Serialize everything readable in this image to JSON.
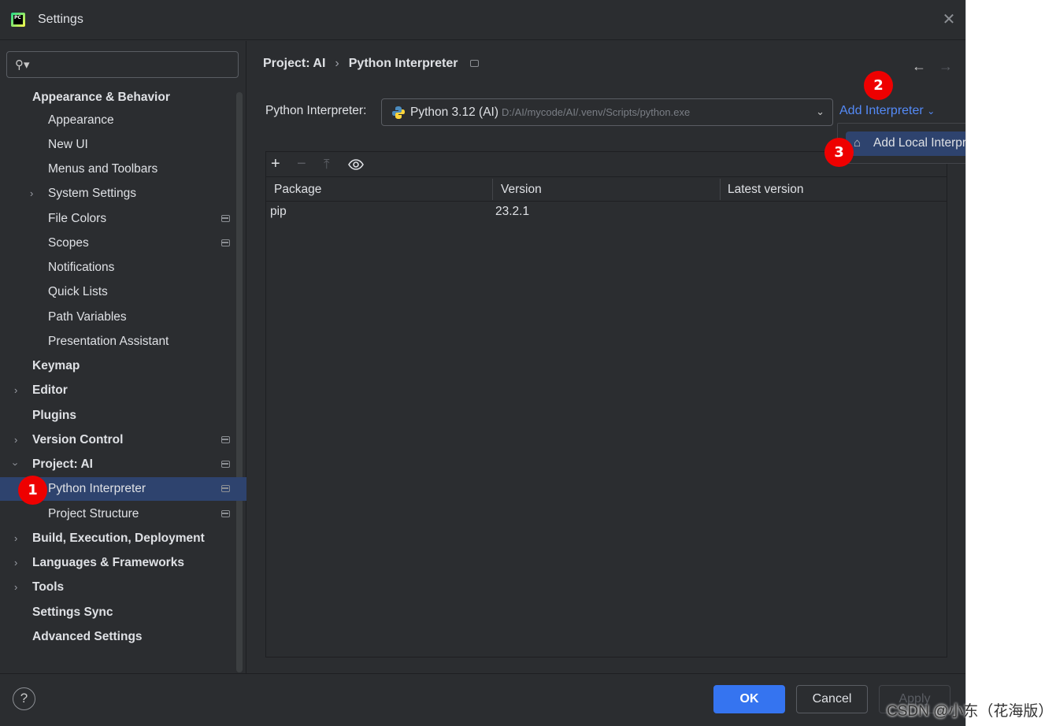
{
  "window": {
    "title": "Settings"
  },
  "sidebar": {
    "items": [
      {
        "label": "Appearance & Behavior"
      },
      {
        "label": "Appearance"
      },
      {
        "label": "New UI"
      },
      {
        "label": "Menus and Toolbars"
      },
      {
        "label": "System Settings"
      },
      {
        "label": "File Colors"
      },
      {
        "label": "Scopes"
      },
      {
        "label": "Notifications"
      },
      {
        "label": "Quick Lists"
      },
      {
        "label": "Path Variables"
      },
      {
        "label": "Presentation Assistant"
      },
      {
        "label": "Keymap"
      },
      {
        "label": "Editor"
      },
      {
        "label": "Plugins"
      },
      {
        "label": "Version Control"
      },
      {
        "label": "Project: AI"
      },
      {
        "label": "Python Interpreter"
      },
      {
        "label": "Project Structure"
      },
      {
        "label": "Build, Execution, Deployment"
      },
      {
        "label": "Languages & Frameworks"
      },
      {
        "label": "Tools"
      },
      {
        "label": "Settings Sync"
      },
      {
        "label": "Advanced Settings"
      }
    ]
  },
  "breadcrumb": {
    "parent": "Project: AI",
    "current": "Python Interpreter"
  },
  "interpreter": {
    "label": "Python Interpreter:",
    "name": "Python 3.12 (AI)",
    "path": "D:/AI/mycode/AI/.venv/Scripts/python.exe",
    "add_label": "Add Interpreter",
    "popup_item": "Add Local Interpreter..."
  },
  "packages": {
    "columns": [
      "Package",
      "Version",
      "Latest version"
    ],
    "rows": [
      {
        "package": "pip",
        "version": "23.2.1",
        "latest": ""
      }
    ]
  },
  "footer": {
    "help": "?",
    "ok": "OK",
    "cancel": "Cancel",
    "apply": "Apply"
  },
  "annotations": {
    "badge1": "1",
    "badge2": "2",
    "badge3": "3"
  },
  "watermark": "CSDN @小东（花海版）",
  "colors": {
    "accent": "#3574f0",
    "link": "#548af7",
    "selection": "#2e436e",
    "badge": "#ee0000",
    "background": "#2b2d30"
  }
}
